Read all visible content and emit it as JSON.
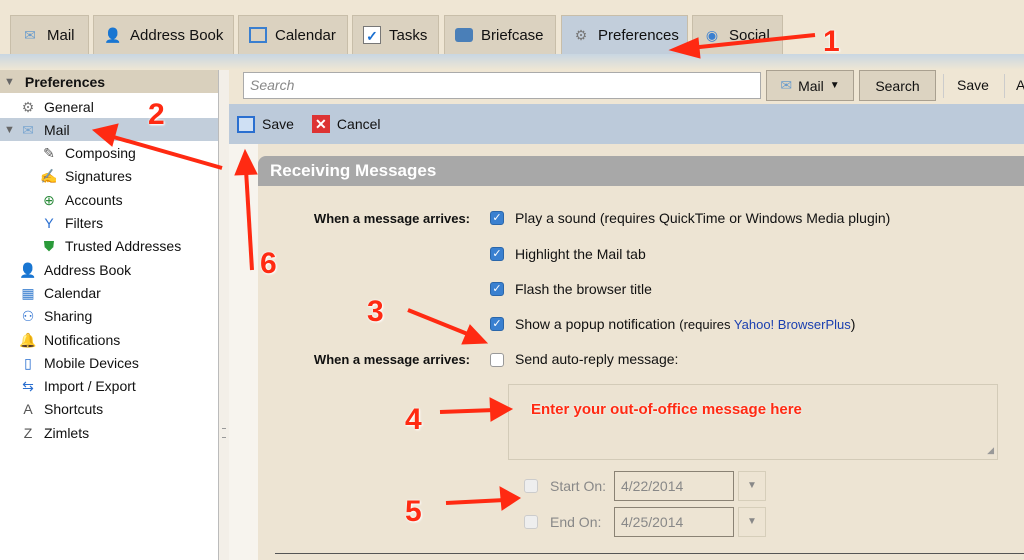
{
  "tabs": [
    {
      "label": "Mail",
      "icon": "envelope-icon"
    },
    {
      "label": "Address Book",
      "icon": "person-icon"
    },
    {
      "label": "Calendar",
      "icon": "calendar-icon"
    },
    {
      "label": "Tasks",
      "icon": "checkbox-icon"
    },
    {
      "label": "Briefcase",
      "icon": "briefcase-icon"
    },
    {
      "label": "Preferences",
      "icon": "gear-icon",
      "selected": true
    },
    {
      "label": "Social",
      "icon": "social-icon"
    }
  ],
  "sidebar": {
    "title": "Preferences",
    "items": [
      {
        "label": "General",
        "icon": "gear-icon"
      },
      {
        "label": "Mail",
        "icon": "envelope-icon",
        "selected": true
      },
      {
        "label": "Composing",
        "icon": "compose-icon"
      },
      {
        "label": "Signatures",
        "icon": "signature-icon"
      },
      {
        "label": "Accounts",
        "icon": "accounts-icon"
      },
      {
        "label": "Filters",
        "icon": "filter-icon"
      },
      {
        "label": "Trusted Addresses",
        "icon": "shield-icon"
      },
      {
        "label": "Address Book",
        "icon": "person-icon"
      },
      {
        "label": "Calendar",
        "icon": "calendar-icon"
      },
      {
        "label": "Sharing",
        "icon": "sharing-icon"
      },
      {
        "label": "Notifications",
        "icon": "bell-icon"
      },
      {
        "label": "Mobile Devices",
        "icon": "mobile-icon"
      },
      {
        "label": "Import / Export",
        "icon": "import-export-icon"
      },
      {
        "label": "Shortcuts",
        "icon": "keyboard-icon"
      },
      {
        "label": "Zimlets",
        "icon": "zimlet-icon"
      }
    ]
  },
  "search": {
    "placeholder": "Search",
    "scope": "Mail",
    "button": "Search",
    "save": "Save",
    "more": "A"
  },
  "toolbar": {
    "save": "Save",
    "cancel": "Cancel"
  },
  "section": {
    "title": "Receiving Messages",
    "label1": "When a message arrives:",
    "options": [
      {
        "label": "Play a sound (requires QuickTime or Windows Media plugin)",
        "checked": true
      },
      {
        "label": "Highlight the Mail tab",
        "checked": true
      },
      {
        "label": "Flash the browser title",
        "checked": true
      },
      {
        "label": "Show a popup notification",
        "suffix": "(requires ",
        "link": "Yahoo! BrowserPlus",
        "close": ")",
        "checked": true
      }
    ],
    "label2": "When a message arrives:",
    "autoreply": {
      "label": "Send auto-reply message:",
      "checked": false
    },
    "message_hint": "Enter your out-of-office message here",
    "start_label": "Start On:",
    "start_date": "4/22/2014",
    "end_label": "End On:",
    "end_date": "4/25/2014"
  },
  "annotations": [
    "1",
    "2",
    "3",
    "4",
    "5",
    "6"
  ],
  "colors": {
    "annotation": "#ff2a12",
    "selected": "#c2cedb",
    "link": "#1a3fb0"
  }
}
